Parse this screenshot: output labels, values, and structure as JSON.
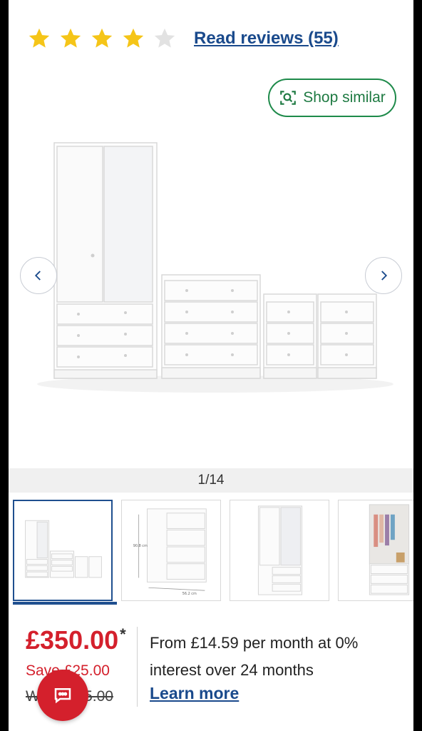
{
  "rating": {
    "stars_filled": 4,
    "stars_total": 5,
    "reviews_label": "Read reviews (55)"
  },
  "shop_similar_label": "Shop similar",
  "gallery": {
    "counter": "1/14",
    "thumbnails": [
      {
        "name": "thumb-furniture-set"
      },
      {
        "name": "thumb-chest-dimensions"
      },
      {
        "name": "thumb-wardrobe"
      },
      {
        "name": "thumb-wardrobe-open"
      }
    ]
  },
  "pricing": {
    "price": "£350.00",
    "asterisk": "*",
    "save": "Save £25.00",
    "was": "Was £375.00",
    "finance_text": "From £14.59 per month at 0% interest over 24 months",
    "learn_more": "Learn more"
  },
  "colors": {
    "star": "#f5c518",
    "star_empty": "#d9d9d9",
    "link": "#1a4a8c",
    "price": "#d4202c",
    "shop_similar": "#1e8a4a"
  },
  "icons": [
    "star-icon",
    "visual-search-icon",
    "chevron-left-icon",
    "chevron-right-icon",
    "chat-icon"
  ]
}
